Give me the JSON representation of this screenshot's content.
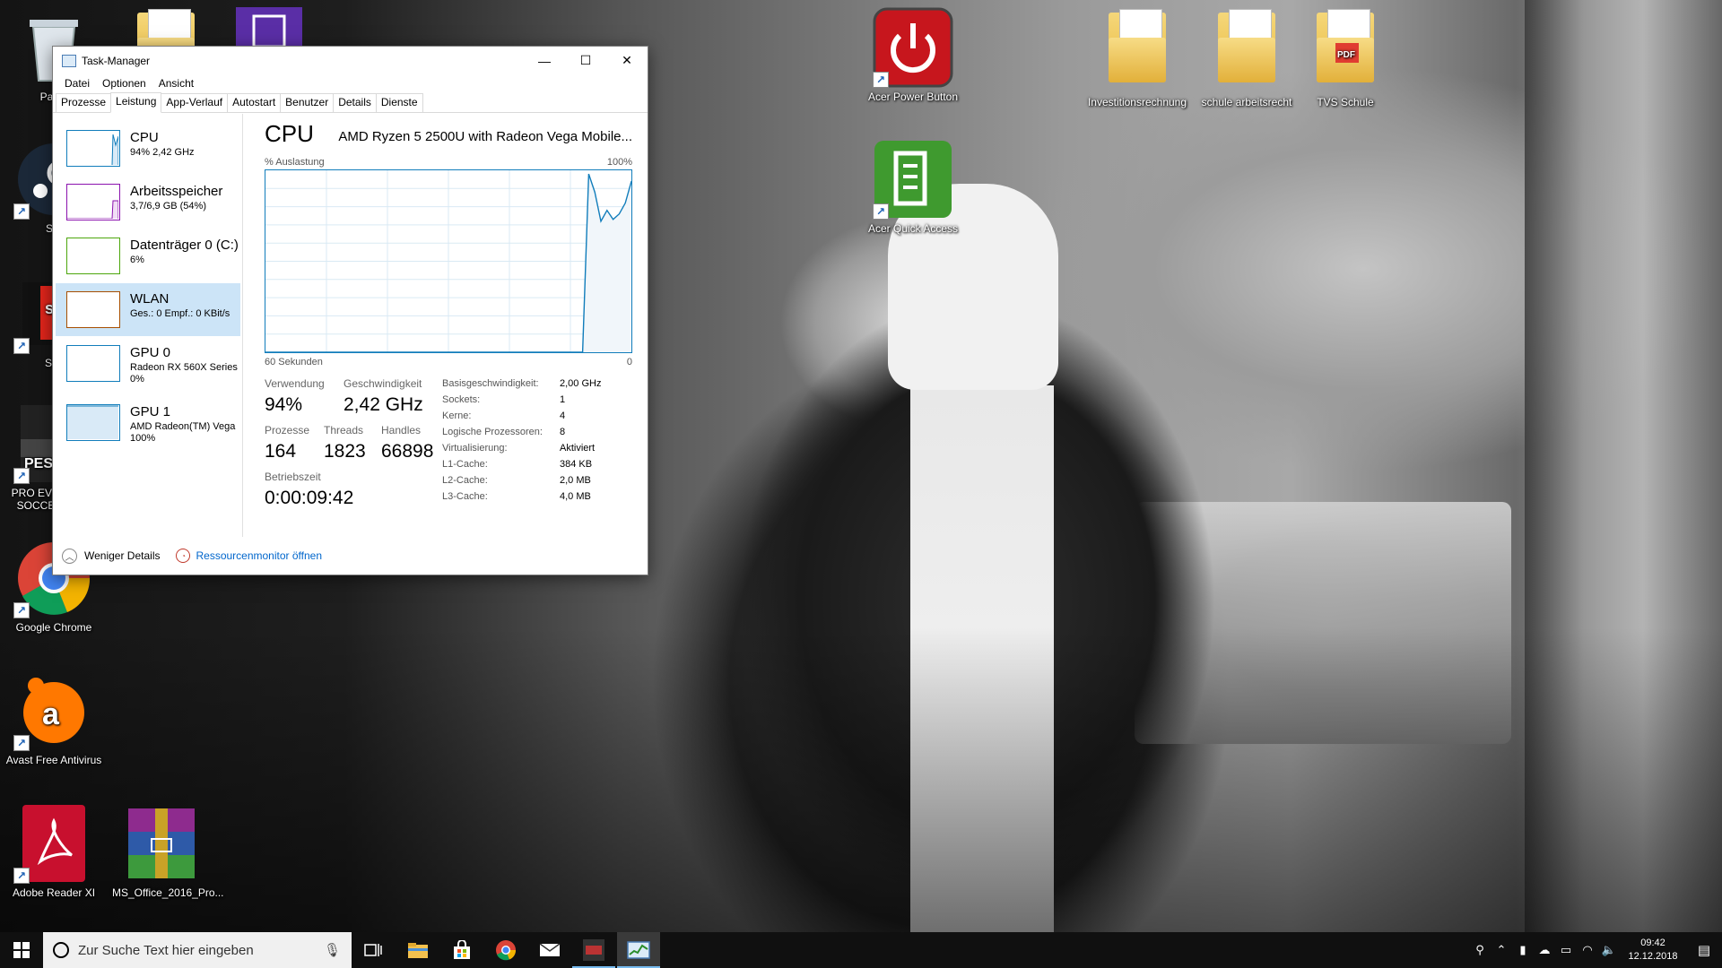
{
  "desktop": {
    "left_icons": [
      {
        "label": "Papie",
        "icon": "recycle-bin"
      },
      {
        "label": "Ste",
        "icon": "steam"
      },
      {
        "label": "Sky",
        "icon": "sky-go"
      },
      {
        "label": "PRO EVO SOCCE",
        "icon": "pes"
      },
      {
        "label": "Google Chrome",
        "icon": "chrome"
      },
      {
        "label": "Avast Free Antivirus",
        "icon": "avast"
      },
      {
        "label": "Adobe Reader XI",
        "icon": "adobe-reader"
      },
      {
        "label": "MS_Office_2016_Pro...",
        "icon": "winrar-archive"
      }
    ],
    "top_icons": [
      {
        "label": "Acer Power Button",
        "icon": "power"
      },
      {
        "label": "Acer Quick Access",
        "icon": "quick-access"
      },
      {
        "label": "Investitionsrechnung",
        "icon": "folder"
      },
      {
        "label": "schule arbeitsrecht",
        "icon": "folder"
      },
      {
        "label": "TVS Schule",
        "icon": "folder-pdf"
      }
    ]
  },
  "task_manager": {
    "title": "Task-Manager",
    "menu": [
      "Datei",
      "Optionen",
      "Ansicht"
    ],
    "tabs": [
      "Prozesse",
      "Leistung",
      "App-Verlauf",
      "Autostart",
      "Benutzer",
      "Details",
      "Dienste"
    ],
    "active_tab": "Leistung",
    "sidebar": [
      {
        "name": "CPU",
        "sub": "94% 2,42 GHz",
        "color": "#117dbb"
      },
      {
        "name": "Arbeitsspeicher",
        "sub": "3,7/6,9 GB (54%)",
        "color": "#8b12ae"
      },
      {
        "name": "Datenträger 0 (C:)",
        "sub": "6%",
        "color": "#4da60c"
      },
      {
        "name": "WLAN",
        "sub": "Ges.: 0 Empf.: 0 KBit/s",
        "color": "#a74f01"
      },
      {
        "name": "GPU 0",
        "sub": "Radeon RX 560X Series",
        "sub2": "0%",
        "color": "#117dbb"
      },
      {
        "name": "GPU 1",
        "sub": "AMD Radeon(TM) Vega",
        "sub2": "100%",
        "color": "#117dbb"
      }
    ],
    "selected_sidebar": "WLAN",
    "main": {
      "title": "CPU",
      "model": "AMD Ryzen 5 2500U with Radeon Vega Mobile...",
      "util_label": "% Auslastung",
      "util_max": "100%",
      "graph_left": "60 Sekunden",
      "graph_right": "0",
      "stats": {
        "usage_label": "Verwendung",
        "usage": "94%",
        "speed_label": "Geschwindigkeit",
        "speed": "2,42 GHz",
        "proc_label": "Prozesse",
        "proc": "164",
        "threads_label": "Threads",
        "threads": "1823",
        "handles_label": "Handles",
        "handles": "66898",
        "uptime_label": "Betriebszeit",
        "uptime": "0:00:09:42"
      },
      "specs": [
        {
          "k": "Basisgeschwindigkeit:",
          "v": "2,00 GHz"
        },
        {
          "k": "Sockets:",
          "v": "1"
        },
        {
          "k": "Kerne:",
          "v": "4"
        },
        {
          "k": "Logische Prozessoren:",
          "v": "8"
        },
        {
          "k": "Virtualisierung:",
          "v": "Aktiviert"
        },
        {
          "k": "L1-Cache:",
          "v": "384 KB"
        },
        {
          "k": "L2-Cache:",
          "v": "2,0 MB"
        },
        {
          "k": "L3-Cache:",
          "v": "4,0 MB"
        }
      ]
    },
    "footer": {
      "fewer": "Weniger Details",
      "resmon": "Ressourcenmonitor öffnen"
    }
  },
  "chart_data": {
    "type": "area",
    "x": [
      60,
      57,
      54,
      51,
      48,
      45,
      42,
      39,
      36,
      33,
      30,
      27,
      24,
      21,
      18,
      15,
      12,
      9,
      8,
      7,
      6,
      5,
      4,
      3,
      2,
      1,
      0
    ],
    "series": [
      {
        "values": [
          0,
          0,
          0,
          0,
          0,
          0,
          0,
          0,
          0,
          0,
          0,
          0,
          0,
          0,
          0,
          0,
          0,
          0,
          0,
          98,
          88,
          72,
          78,
          73,
          76,
          82,
          94
        ]
      }
    ],
    "ylim": [
      0,
      100
    ],
    "grid": true
  },
  "taskbar": {
    "search_placeholder": "Zur Suche Text hier eingeben",
    "time": "09:42",
    "date": "12.12.2018"
  },
  "colors": {
    "accent": "#117dbb",
    "selection": "#cce4f7",
    "taskbar": "#101010"
  }
}
